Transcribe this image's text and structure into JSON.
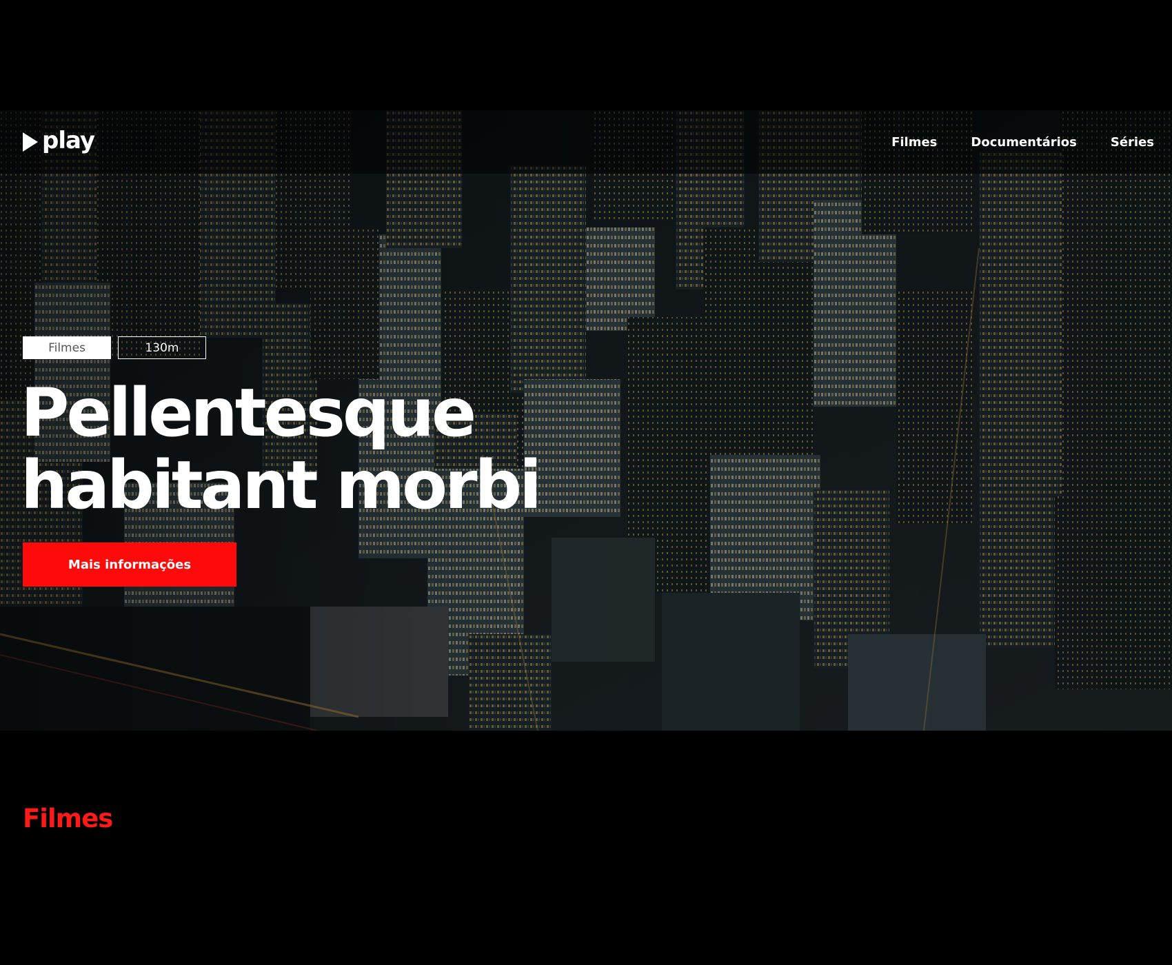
{
  "brand": {
    "name": "play",
    "logo_icon": "play-triangle-icon"
  },
  "nav": {
    "items": [
      {
        "label": "Filmes"
      },
      {
        "label": "Documentários"
      },
      {
        "label": "Séries"
      }
    ]
  },
  "hero": {
    "tags": [
      {
        "label": "Filmes"
      },
      {
        "label": "130m"
      }
    ],
    "title_line1": "Pellentesque",
    "title_line2": "habitant morbi",
    "cta_label": "Mais informações",
    "background": "night-city-aerial-image"
  },
  "section": {
    "title": "Filmes"
  },
  "colors": {
    "accent": "#ff0a0a",
    "background": "#000000",
    "text": "#ffffff"
  }
}
